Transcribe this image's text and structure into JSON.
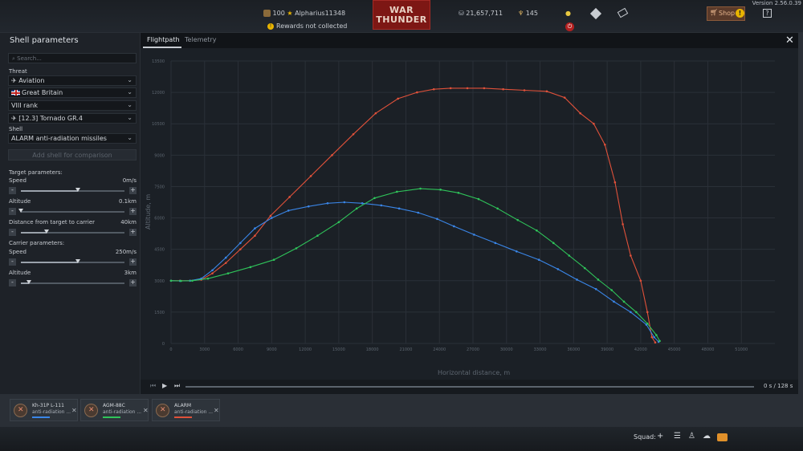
{
  "topbar": {
    "rank": "100",
    "player_name": "Alpharius11348",
    "logo_line1": "WAR",
    "logo_line2": "THUNDER",
    "silver_lions": "21,657,711",
    "golden_eagles": "145",
    "shop_label": "Shop",
    "shop_badge": "!",
    "help_label": "?",
    "version": "Version 2.56.0.39",
    "rewards_text": "Rewards not collected"
  },
  "left_panel": {
    "title": "Shell parameters",
    "search_placeholder": "Search...",
    "threat_label": "Threat",
    "threat_type": "Aviation",
    "country": "Great Britain",
    "rank": "VIII rank",
    "vehicle": "[12.3] Tornado GR.4",
    "shell_label": "Shell",
    "shell": "ALARM anti-radiation missiles",
    "add_shell": "Add shell for comparison",
    "target_params_label": "Target parameters:",
    "target_speed_label": "Speed",
    "target_speed_value": "0m/s",
    "target_speed_fraction": 0.55,
    "target_altitude_label": "Altitude",
    "target_altitude_value": "0.1km",
    "target_altitude_fraction": 0.0,
    "distance_label": "Distance from target to carrier",
    "distance_value": "40km",
    "distance_fraction": 0.25,
    "carrier_params_label": "Carrier parameters:",
    "carrier_speed_label": "Speed",
    "carrier_speed_value": "250m/s",
    "carrier_speed_fraction": 0.55,
    "carrier_altitude_label": "Altitude",
    "carrier_altitude_value": "3km",
    "carrier_altitude_fraction": 0.08,
    "minus": "-",
    "plus": "+"
  },
  "main_panel": {
    "tabs": [
      "Flightpath",
      "Telemetry"
    ],
    "close": "✕",
    "play_time": "0 s  /  128 s"
  },
  "chart_data": {
    "type": "line",
    "xlabel": "Horizontal distance, m",
    "ylabel": "Altitude, m",
    "xlim": [
      0,
      54000
    ],
    "ylim": [
      0,
      13500
    ],
    "x_ticks": [
      0,
      3000,
      6000,
      9000,
      12000,
      15000,
      18000,
      21000,
      24000,
      27000,
      30000,
      33000,
      36000,
      39000,
      42000,
      45000,
      48000,
      51000
    ],
    "y_ticks": [
      0,
      1500,
      3000,
      4500,
      6000,
      7500,
      9000,
      10500,
      12000,
      13500
    ],
    "grid": true,
    "series": [
      {
        "color": "#e0513a",
        "points": [
          [
            0,
            3000
          ],
          [
            800,
            3000
          ],
          [
            1700,
            3000
          ],
          [
            2700,
            3050
          ],
          [
            3700,
            3350
          ],
          [
            4900,
            3850
          ],
          [
            6200,
            4500
          ],
          [
            7500,
            5150
          ],
          [
            8900,
            6100
          ],
          [
            10600,
            7000
          ],
          [
            12500,
            8000
          ],
          [
            14400,
            9000
          ],
          [
            16300,
            10000
          ],
          [
            18300,
            11000
          ],
          [
            20300,
            11700
          ],
          [
            22000,
            12000
          ],
          [
            23500,
            12150
          ],
          [
            25000,
            12200
          ],
          [
            26500,
            12200
          ],
          [
            28000,
            12200
          ],
          [
            29700,
            12150
          ],
          [
            31600,
            12100
          ],
          [
            33600,
            12050
          ],
          [
            35200,
            11750
          ],
          [
            36600,
            11000
          ],
          [
            37800,
            10500
          ],
          [
            38800,
            9500
          ],
          [
            39700,
            7700
          ],
          [
            40400,
            5700
          ],
          [
            41100,
            4200
          ],
          [
            42000,
            3000
          ],
          [
            42600,
            1500
          ],
          [
            43000,
            300
          ],
          [
            43300,
            50
          ]
        ]
      },
      {
        "color": "#3a86e8",
        "points": [
          [
            0,
            3000
          ],
          [
            800,
            2990
          ],
          [
            1700,
            3000
          ],
          [
            2700,
            3100
          ],
          [
            3700,
            3500
          ],
          [
            4900,
            4100
          ],
          [
            6200,
            4800
          ],
          [
            7500,
            5500
          ],
          [
            9000,
            6000
          ],
          [
            10500,
            6350
          ],
          [
            12300,
            6550
          ],
          [
            14000,
            6700
          ],
          [
            15500,
            6750
          ],
          [
            17100,
            6700
          ],
          [
            18800,
            6600
          ],
          [
            20400,
            6450
          ],
          [
            22100,
            6250
          ],
          [
            23800,
            5950
          ],
          [
            25300,
            5600
          ],
          [
            27100,
            5200
          ],
          [
            29000,
            4800
          ],
          [
            30900,
            4400
          ],
          [
            32900,
            4000
          ],
          [
            34600,
            3550
          ],
          [
            36300,
            3050
          ],
          [
            38000,
            2600
          ],
          [
            39600,
            2000
          ],
          [
            41100,
            1500
          ],
          [
            42500,
            900
          ],
          [
            43200,
            300
          ],
          [
            43600,
            80
          ]
        ]
      },
      {
        "color": "#2fc45a",
        "points": [
          [
            0,
            3000
          ],
          [
            900,
            2990
          ],
          [
            1900,
            3000
          ],
          [
            3300,
            3100
          ],
          [
            5100,
            3350
          ],
          [
            7100,
            3650
          ],
          [
            9200,
            4000
          ],
          [
            11200,
            4550
          ],
          [
            13100,
            5150
          ],
          [
            15000,
            5800
          ],
          [
            16600,
            6450
          ],
          [
            18200,
            6950
          ],
          [
            20200,
            7250
          ],
          [
            22300,
            7400
          ],
          [
            24100,
            7350
          ],
          [
            25700,
            7200
          ],
          [
            27500,
            6900
          ],
          [
            29200,
            6450
          ],
          [
            31000,
            5900
          ],
          [
            32700,
            5400
          ],
          [
            34200,
            4800
          ],
          [
            35600,
            4200
          ],
          [
            37000,
            3600
          ],
          [
            38200,
            3050
          ],
          [
            39400,
            2550
          ],
          [
            40500,
            2000
          ],
          [
            41600,
            1500
          ],
          [
            42600,
            950
          ],
          [
            43400,
            400
          ],
          [
            43700,
            120
          ]
        ]
      }
    ]
  },
  "shell_cards": [
    {
      "name": "Kh-31P L-111",
      "type": "anti-radiation ...",
      "color": "#3a86e8",
      "close": "✕"
    },
    {
      "name": "AGM-88C",
      "type": "anti-radiation ...",
      "color": "#2fc45a",
      "close": "✕"
    },
    {
      "name": "ALARM",
      "type": "anti-radiation ...",
      "color": "#e0513a",
      "close": "✕"
    }
  ],
  "bottombar": {
    "squad_label": "Squad:",
    "add_icon": "+",
    "list_icon": "☰",
    "person_icon": "♙",
    "chat_icon": "☁"
  }
}
